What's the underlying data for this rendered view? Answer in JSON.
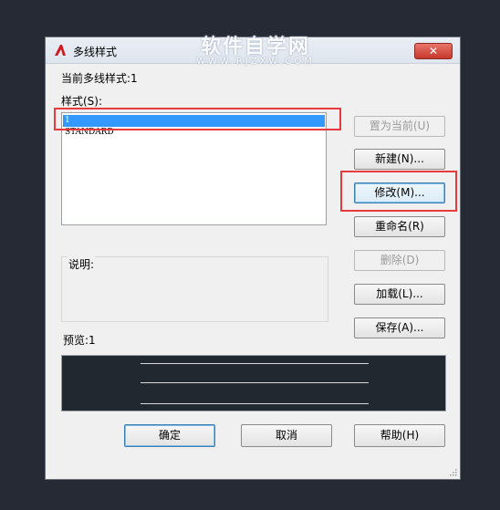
{
  "window": {
    "title": "多线样式",
    "close_label": "✕"
  },
  "watermark": {
    "main": "软件自学网",
    "sub": "WWW.RJZXW.COM"
  },
  "current_style": "当前多线样式:1",
  "styles_label": "样式(S):",
  "styles": [
    {
      "name": "1",
      "selected": true
    },
    {
      "name": "STANDARD",
      "selected": false
    }
  ],
  "description_label": "说明:",
  "preview_label": "预览:1",
  "buttons": {
    "set_current": "置为当前(U)",
    "new": "新建(N)...",
    "modify": "修改(M)...",
    "rename": "重命名(R)",
    "delete": "删除(D)",
    "load": "加载(L)...",
    "save": "保存(A)...",
    "ok": "确定",
    "cancel": "取消",
    "help": "帮助(H)"
  },
  "colors": {
    "selection": "#3399ff",
    "highlight": "#e8393c",
    "preview_bg": "#212830"
  },
  "icons": [
    "autocad-logo-icon",
    "close-icon",
    "resize-grip-icon"
  ]
}
